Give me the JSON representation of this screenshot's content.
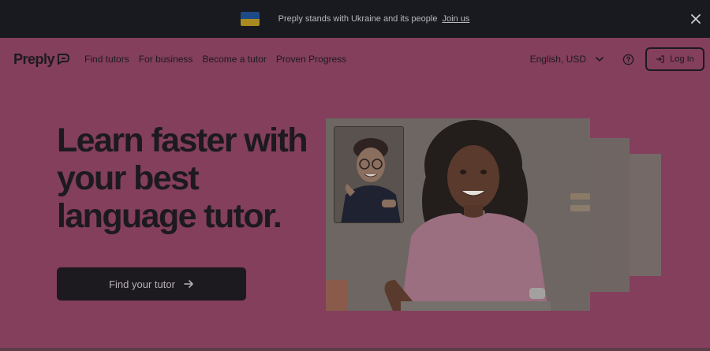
{
  "banner": {
    "text": "Preply stands with Ukraine and its people",
    "link": "Join us",
    "flag_colors": [
      "#1f5aa8",
      "#d9b021"
    ],
    "close_icon": "close-icon"
  },
  "nav": {
    "logo_text": "Preply",
    "links": [
      "Find tutors",
      "For business",
      "Become a tutor",
      "Proven Progress"
    ],
    "language": "English, USD",
    "login": "Log In",
    "icons": [
      "chevron-down-icon",
      "help-icon",
      "login-icon"
    ]
  },
  "hero": {
    "headline": "Learn faster with your best language tutor.",
    "cta": "Find your tutor",
    "cta_icon": "arrow-right-icon",
    "background": "#833f5c"
  }
}
